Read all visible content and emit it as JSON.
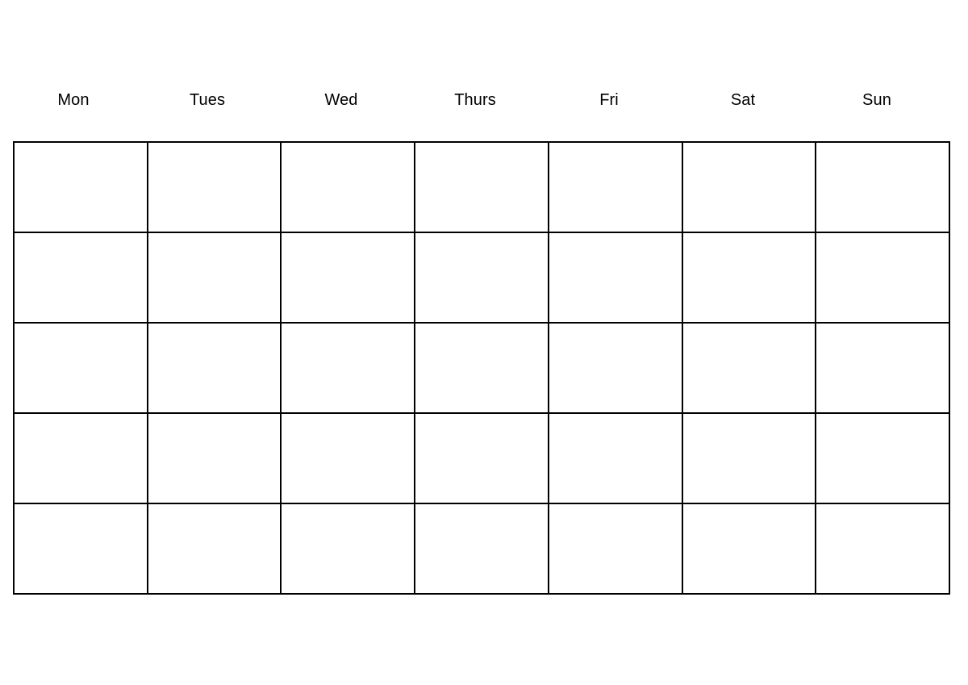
{
  "page": {
    "title": "Blank Weekly Calendar Grid",
    "background_color": "#ffffff",
    "text_color": "#000000",
    "border_color": "#000000"
  },
  "header": {
    "weekdays": [
      {
        "label": "Mon"
      },
      {
        "label": "Tues"
      },
      {
        "label": "Wed"
      },
      {
        "label": "Thurs"
      },
      {
        "label": "Fri"
      },
      {
        "label": "Sat"
      },
      {
        "label": "Sun"
      }
    ]
  },
  "grid": {
    "columns": 7,
    "rows": 5,
    "cells": [
      [
        {
          "text": ""
        },
        {
          "text": ""
        },
        {
          "text": ""
        },
        {
          "text": ""
        },
        {
          "text": ""
        },
        {
          "text": ""
        },
        {
          "text": ""
        }
      ],
      [
        {
          "text": ""
        },
        {
          "text": ""
        },
        {
          "text": ""
        },
        {
          "text": ""
        },
        {
          "text": ""
        },
        {
          "text": ""
        },
        {
          "text": ""
        }
      ],
      [
        {
          "text": ""
        },
        {
          "text": ""
        },
        {
          "text": ""
        },
        {
          "text": ""
        },
        {
          "text": ""
        },
        {
          "text": ""
        },
        {
          "text": ""
        }
      ],
      [
        {
          "text": ""
        },
        {
          "text": ""
        },
        {
          "text": ""
        },
        {
          "text": ""
        },
        {
          "text": ""
        },
        {
          "text": ""
        },
        {
          "text": ""
        }
      ],
      [
        {
          "text": ""
        },
        {
          "text": ""
        },
        {
          "text": ""
        },
        {
          "text": ""
        },
        {
          "text": ""
        },
        {
          "text": ""
        },
        {
          "text": ""
        }
      ]
    ]
  }
}
